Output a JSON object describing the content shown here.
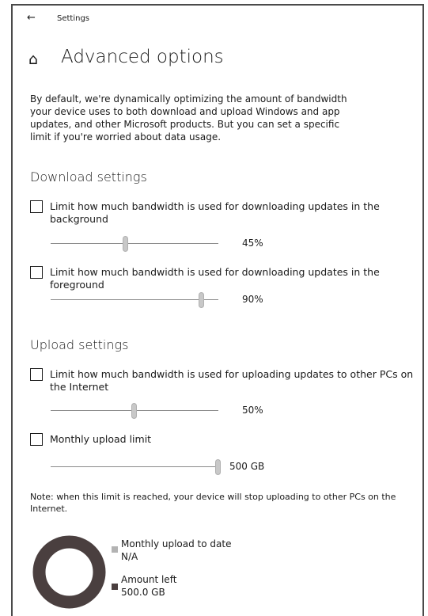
{
  "window": {
    "back_icon": "arrow-left-icon",
    "title": "Settings"
  },
  "page": {
    "home_icon": "home-icon",
    "title": "Advanced options"
  },
  "intro": "By default, we're dynamically optimizing the amount of bandwidth your device uses to both download and upload Windows and app updates, and other Microsoft products. But you can set a specific limit if you're worried about data usage.",
  "download": {
    "heading": "Download settings",
    "background": {
      "label": "Limit how much bandwidth is used for downloading updates in the background",
      "checked": false,
      "slider_fraction": 0.45,
      "value_label": "45%"
    },
    "foreground": {
      "label": "Limit how much bandwidth is used for downloading updates in the foreground",
      "checked": false,
      "slider_fraction": 0.9,
      "value_label": "90%"
    }
  },
  "upload": {
    "heading": "Upload settings",
    "internet": {
      "label": "Limit how much bandwidth is used for uploading updates to other PCs on the Internet",
      "checked": false,
      "slider_fraction": 0.5,
      "value_label": "50%"
    },
    "monthly": {
      "label": "Monthly upload limit",
      "checked": false,
      "slider_fraction": 1.0,
      "value_label": "500 GB"
    },
    "note": "Note: when this limit is reached, your device will stop uploading to other PCs on the Internet."
  },
  "usage": {
    "uploaded": {
      "label": "Monthly upload to date",
      "value": "N/A",
      "color": "#b3b3b3"
    },
    "left": {
      "label": "Amount left",
      "value": "500.0 GB",
      "color": "#4a3f3f"
    },
    "ring_color": "#4a3f3f"
  }
}
